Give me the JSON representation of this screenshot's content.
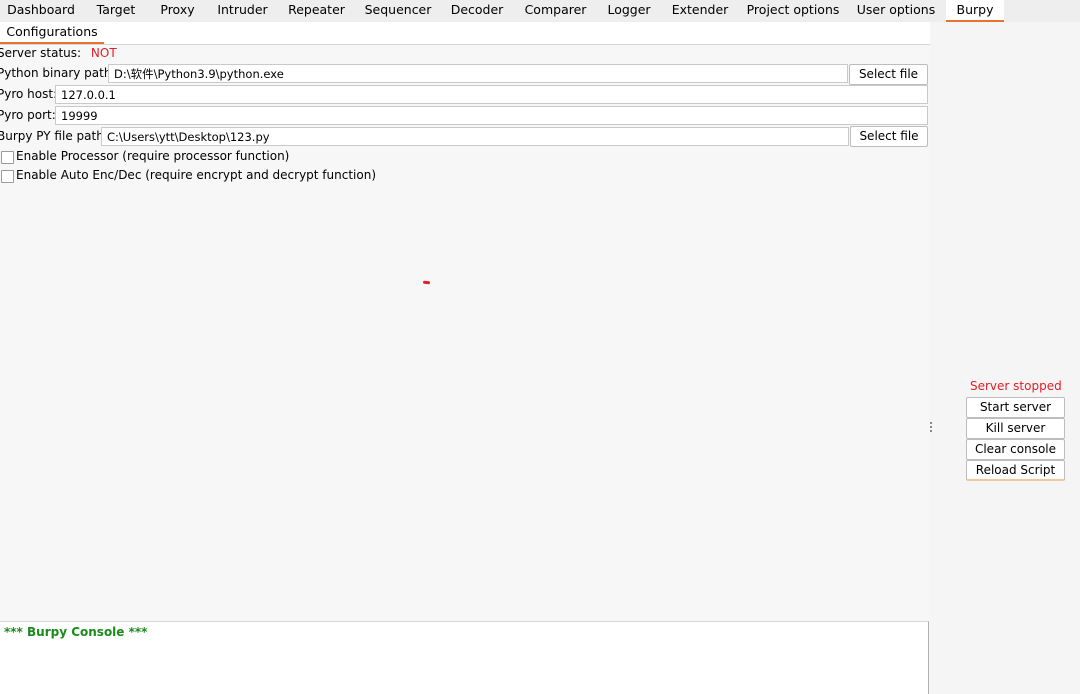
{
  "top_tabs": [
    "Dashboard",
    "Target",
    "Proxy",
    "Intruder",
    "Repeater",
    "Sequencer",
    "Decoder",
    "Comparer",
    "Logger",
    "Extender",
    "Project options",
    "User options",
    "Burpy"
  ],
  "active_top_tab": "Burpy",
  "sub_tabs": [
    "Configurations"
  ],
  "config": {
    "server_status_label": "Server status:",
    "server_status_value": "NOT",
    "python_binary_label": "Python binary path:",
    "python_binary_value": "D:\\软件\\Python3.9\\python.exe",
    "pyro_host_label": "Pyro host:",
    "pyro_host_value": "127.0.0.1",
    "pyro_port_label": "Pyro port:",
    "pyro_port_value": "19999",
    "burpy_py_label": "Burpy PY file path:",
    "burpy_py_value": "C:\\Users\\ytt\\Desktop\\123.py",
    "select_file_label": "Select file",
    "enable_processor_label": "Enable Processor (require processor function)",
    "enable_auto_encdec_label": "Enable Auto Enc/Dec (require encrypt and decrypt function)"
  },
  "side_panel": {
    "server_status": "Server stopped",
    "start_server": "Start server",
    "kill_server": "Kill server",
    "clear_console": "Clear console",
    "reload_script": "Reload Script"
  },
  "console": {
    "header": "*** Burpy Console ***"
  },
  "colors": {
    "accent": "#e8722e",
    "status_red": "#e0202a",
    "console_green": "#1a8a1a"
  }
}
